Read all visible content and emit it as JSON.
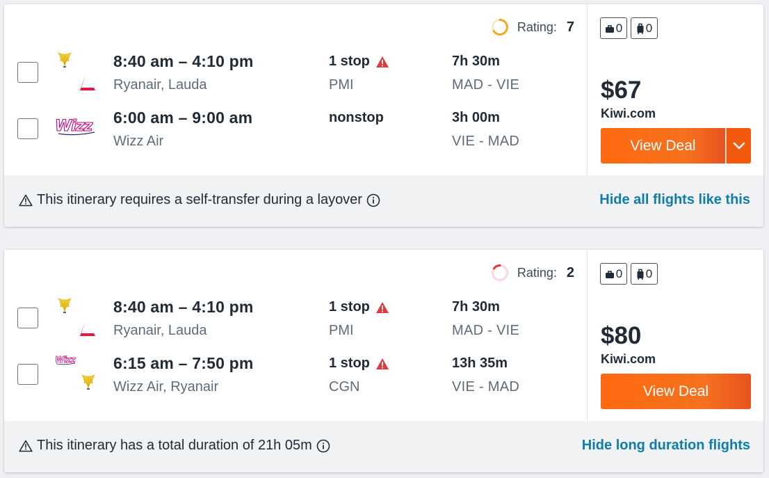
{
  "results": [
    {
      "rating_label": "Rating:",
      "rating_value": "7",
      "rating_color": "#f5a623",
      "legs": [
        {
          "time": "8:40 am – 4:10 pm",
          "airline": "Ryanair, Lauda",
          "stops": "1 stop",
          "stop_airport": "PMI",
          "duration": "7h 30m",
          "route": "MAD - VIE",
          "logos": [
            "ryanair-logo",
            "lauda-logo"
          ],
          "warning_icon": "warning-icon"
        },
        {
          "time": "6:00 am – 9:00 am",
          "airline": "Wizz Air",
          "stops": "nonstop",
          "stop_airport": "",
          "duration": "3h 00m",
          "route": "VIE - MAD",
          "logos": [
            "wizz-logo"
          ]
        }
      ],
      "bags": {
        "carry_on": "0",
        "checked": "0"
      },
      "price": "$67",
      "provider": "Kiwi.com",
      "cta": "View Deal",
      "has_dropdown": true,
      "notice": "This itinerary requires a self-transfer during a layover",
      "hide_link": "Hide all flights like this"
    },
    {
      "rating_label": "Rating:",
      "rating_value": "2",
      "rating_color": "#e03a3e",
      "legs": [
        {
          "time": "8:40 am – 4:10 pm",
          "airline": "Ryanair, Lauda",
          "stops": "1 stop",
          "stop_airport": "PMI",
          "duration": "7h 30m",
          "route": "MAD - VIE",
          "logos": [
            "ryanair-logo",
            "lauda-logo"
          ],
          "warning_icon": "warning-icon"
        },
        {
          "time": "6:15 am – 7:50 pm",
          "airline": "Wizz Air, Ryanair",
          "stops": "1 stop",
          "stop_airport": "CGN",
          "duration": "13h 35m",
          "route": "VIE - MAD",
          "logos": [
            "wizz-logo",
            "ryanair-logo"
          ],
          "warning_icon": "warning-icon"
        }
      ],
      "bags": {
        "carry_on": "0",
        "checked": "0"
      },
      "price": "$80",
      "provider": "Kiwi.com",
      "cta": "View Deal",
      "has_dropdown": false,
      "notice": "This itinerary has a total duration of 21h 05m",
      "hide_link": "Hide long duration flights"
    }
  ],
  "colors": {
    "accent_orange": "#ff690f",
    "link_blue": "#0f7dab",
    "warning_red": "#e03a3e"
  }
}
